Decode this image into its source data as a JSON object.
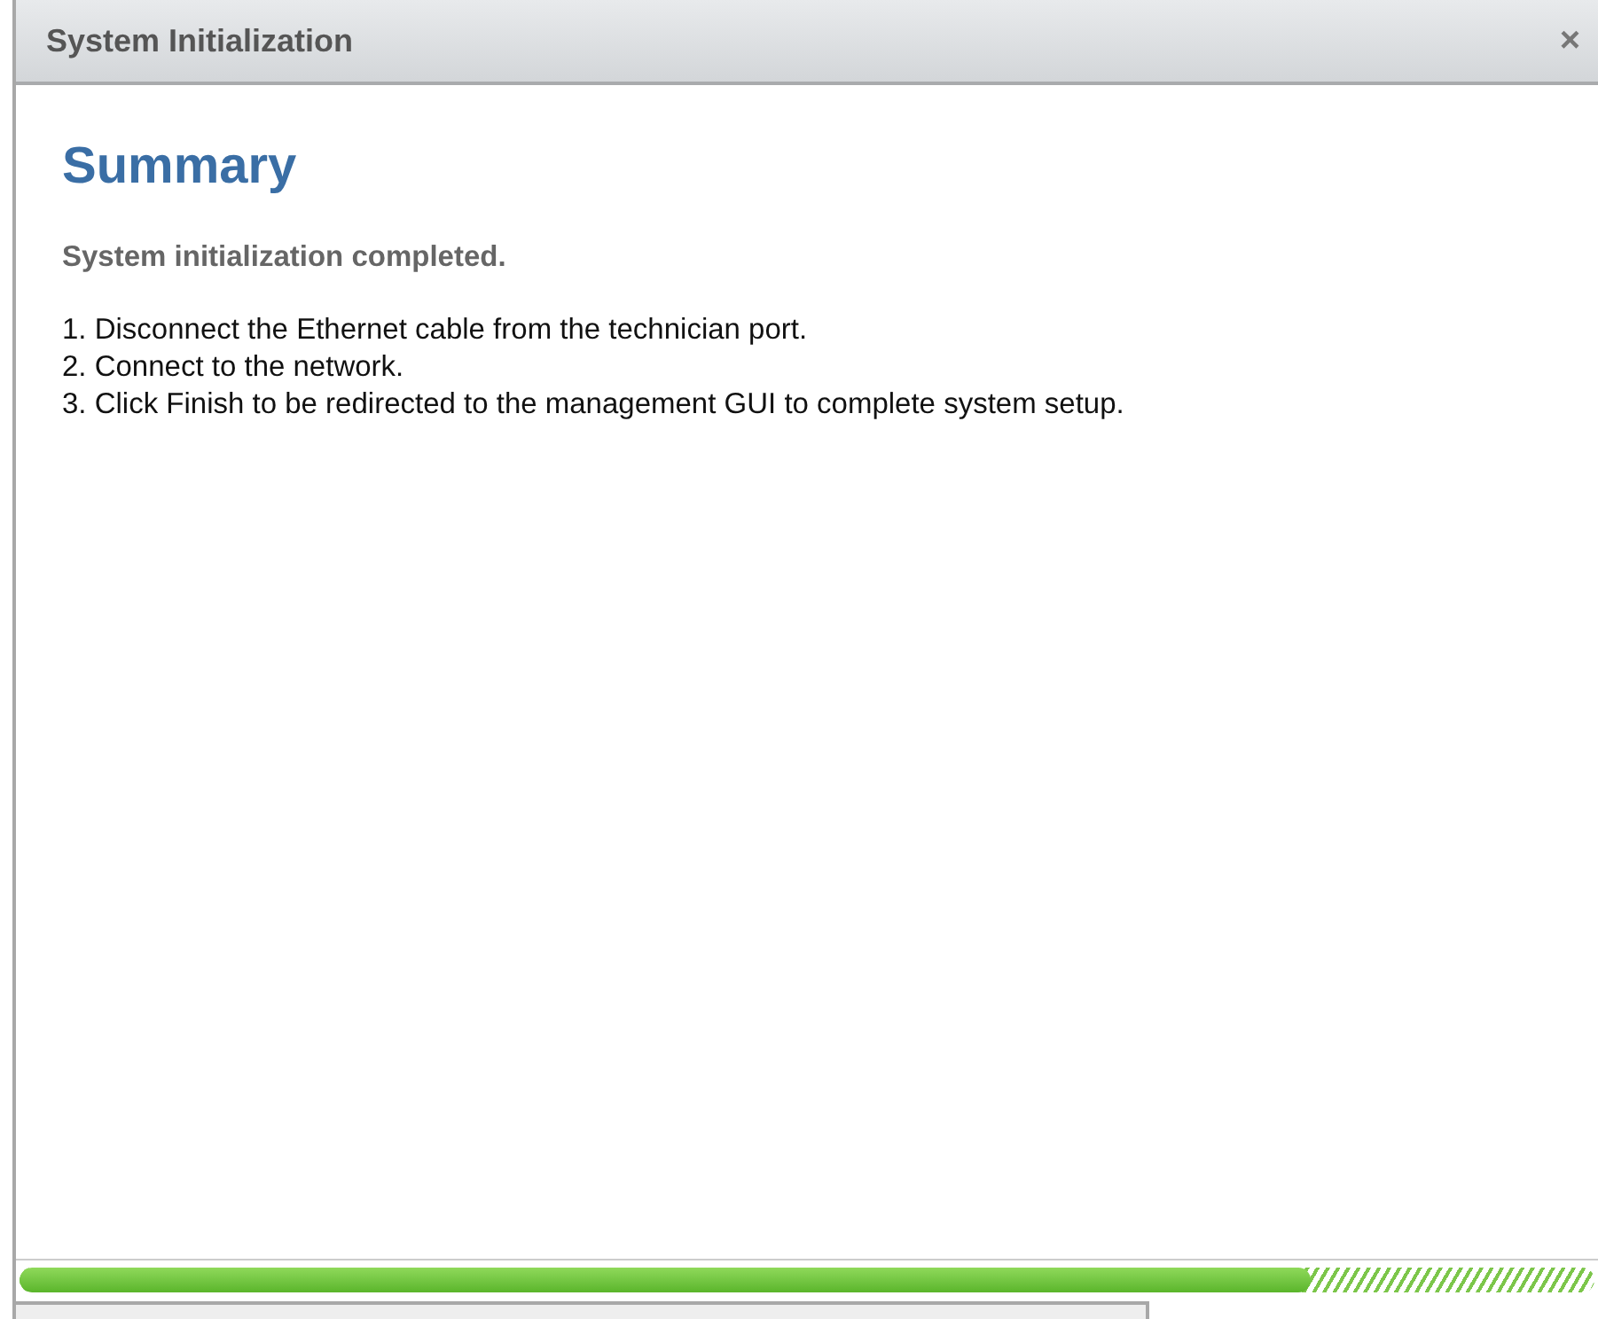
{
  "window": {
    "title": "System Initialization",
    "close": "×"
  },
  "heading": "Summary",
  "status": "System initialization completed.",
  "steps": [
    "1. Disconnect the Ethernet cable from the technician port.",
    "2. Connect to the network.",
    "3. Click Finish to be redirected to the management GUI to complete system setup."
  ],
  "progress": {
    "level": 0.82
  }
}
